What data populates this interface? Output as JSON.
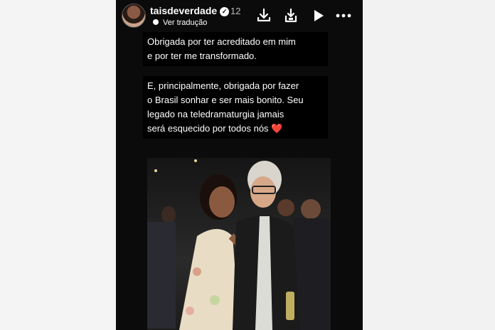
{
  "header": {
    "username": "taisdeverdade",
    "time": "12",
    "translate_label": "Ver tradução",
    "icons": [
      "download-icon",
      "save-icon",
      "play-icon",
      "more-icon"
    ]
  },
  "caption": {
    "paragraph1": [
      "Obrigada por ter acreditado em mim",
      "e por ter me transformado."
    ],
    "paragraph2": [
      "E, principalmente, obrigada por fazer",
      "o Brasil sonhar e ser mais bonito. Seu",
      "legado na teledramaturgia jamais",
      "será esquecido por todos nós ❤️"
    ]
  },
  "colors": {
    "background": "#0b0b0b",
    "text": "#ffffff",
    "heart": "#e0202a"
  }
}
